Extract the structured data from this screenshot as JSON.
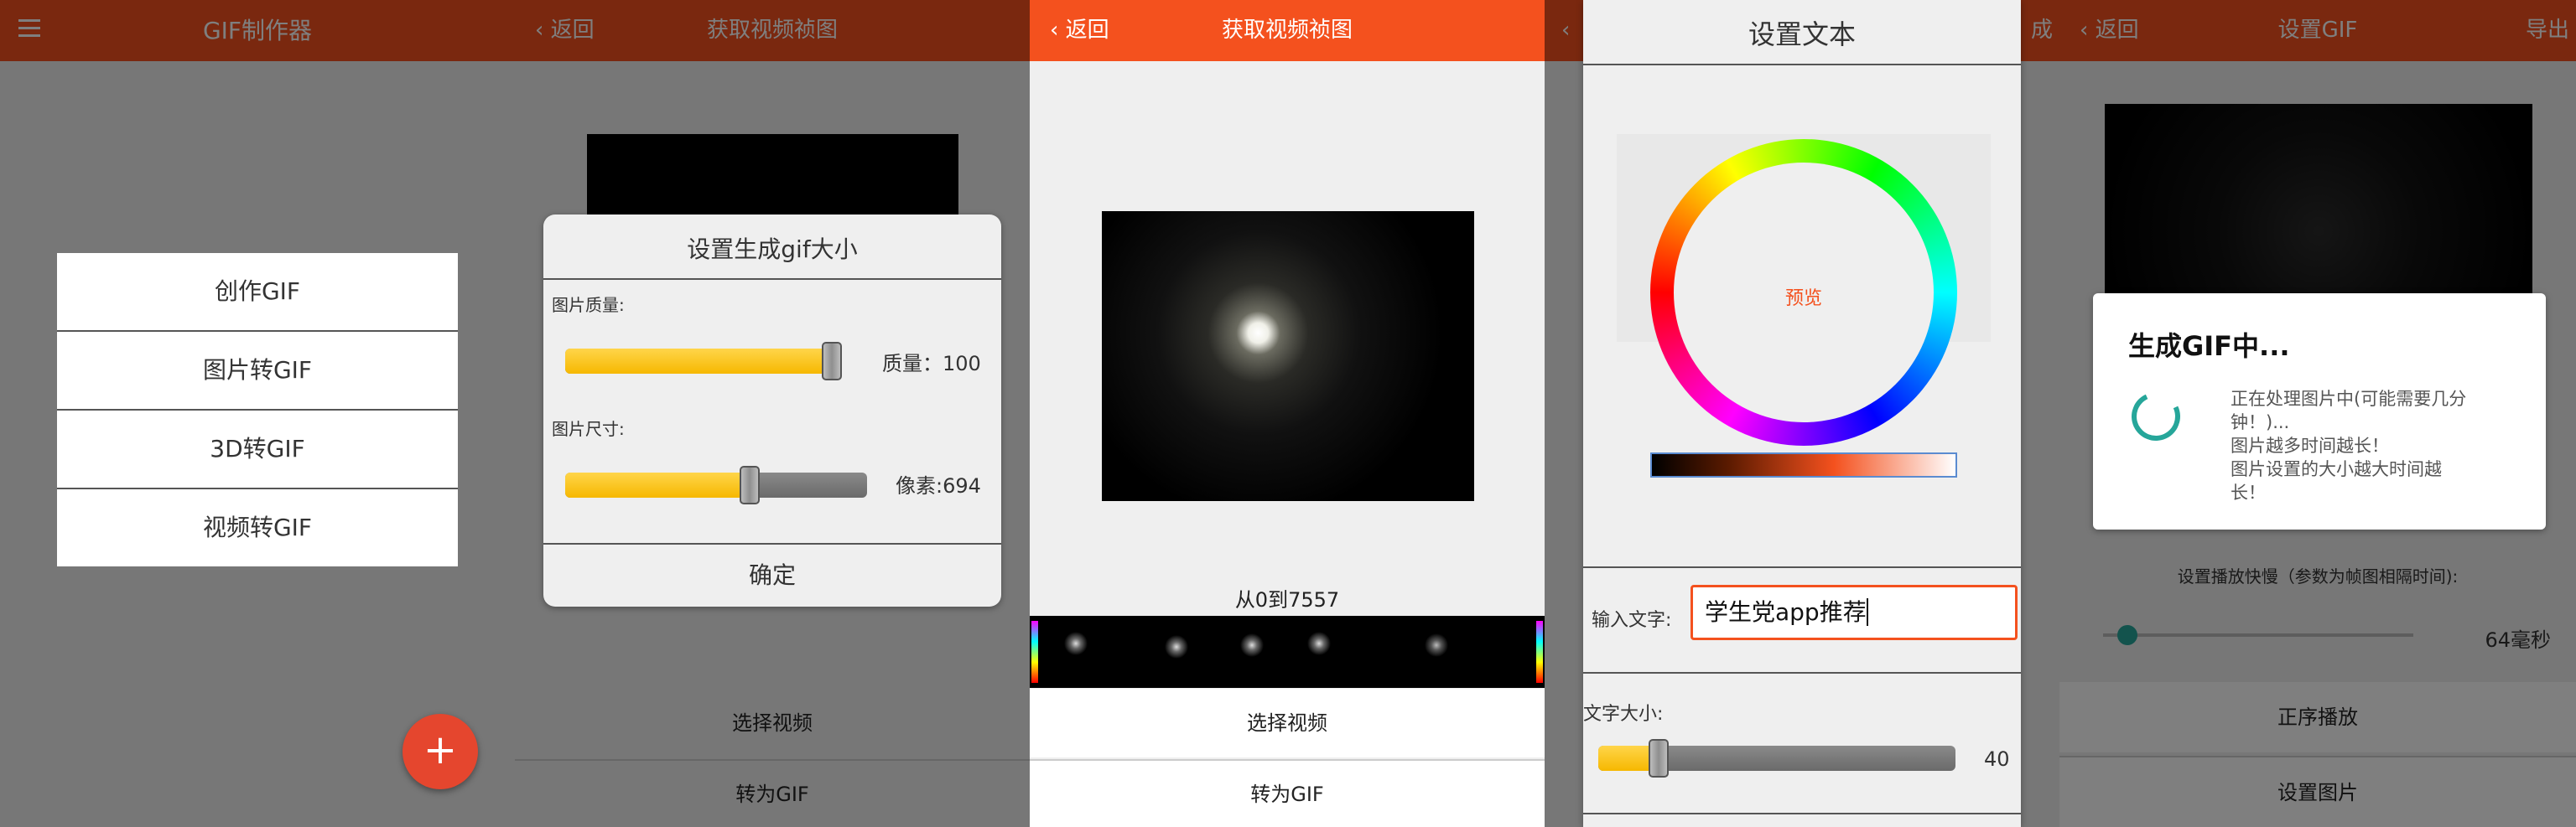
{
  "colors": {
    "accent": "#f4511e",
    "fab": "#e5462e",
    "spinner": "#26a69a",
    "preview": "#f4511e"
  },
  "screen1": {
    "title": "GIF制作器",
    "menu_icon": "hamburger-menu-icon",
    "menu_items": [
      "创作GIF",
      "图片转GIF",
      "3D转GIF",
      "视频转GIF"
    ],
    "fab_label": "+"
  },
  "screen2": {
    "back_label": "返回",
    "title": "获取视频祯图",
    "dialog": {
      "title": "设置生成gif大小",
      "quality_label": "图片质量:",
      "quality_value": "质量：100",
      "quality_fraction": 1.0,
      "size_label": "图片尺寸:",
      "size_value": "像素:694",
      "size_fraction": 0.62,
      "confirm_label": "确定"
    },
    "select_video_label": "选择视频",
    "to_gif_label": "转为GIF"
  },
  "screen3": {
    "back_label": "返回",
    "title": "获取视频祯图",
    "range_label": "从0到7557",
    "select_video_label": "选择视频",
    "to_gif_label": "转为GIF"
  },
  "screen4": {
    "dialog_title": "设置文本",
    "preview_label": "预览",
    "partial_header_text": "成",
    "input_label": "输入文字:",
    "input_value": "学生党app推荐",
    "font_size_label": "文字大小:",
    "font_size_value": "40",
    "font_size_fraction": 0.15
  },
  "screen5": {
    "back_label": "返回",
    "title": "设置GIF",
    "export_label": "导出",
    "dialog_title": "生成GIF中...",
    "dialog_lines": [
      "正在处理图片中(可能需要几分",
      "钟！)...",
      "图片越多时间越长！",
      "图片设置的大小越大时间越",
      "长！"
    ],
    "speed_label": "设置播放快慢（参数为帧图相隔时间):",
    "speed_value": "64毫秒",
    "speed_fraction": 0.05,
    "forward_play_label": "正序播放",
    "set_image_label": "设置图片"
  }
}
